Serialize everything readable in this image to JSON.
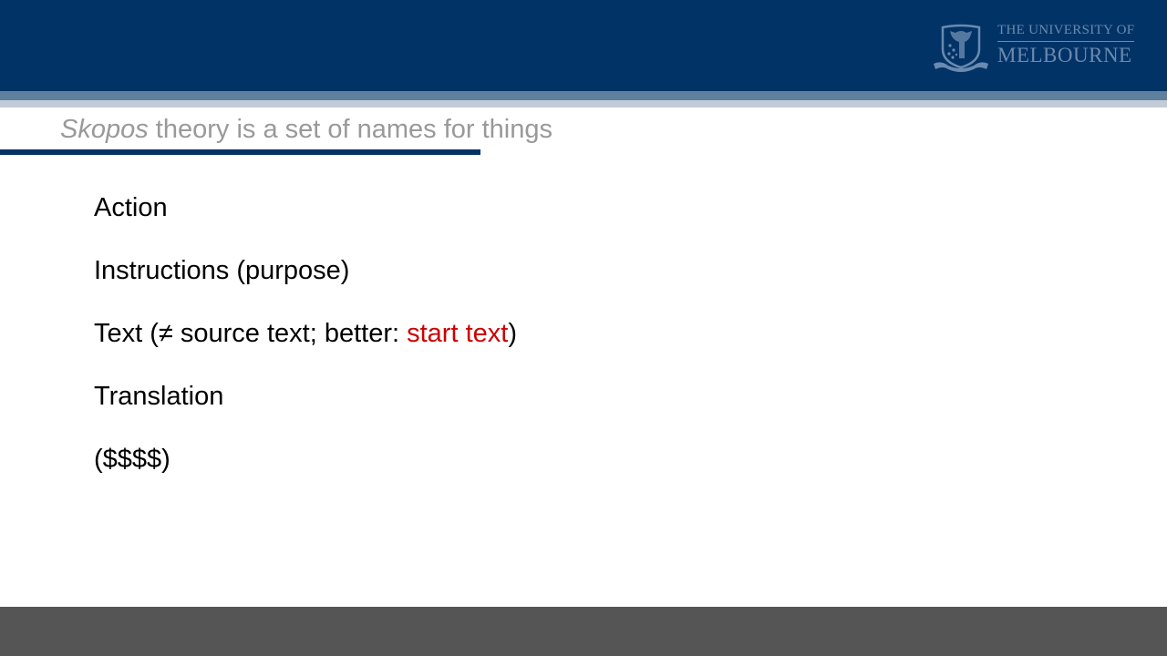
{
  "header": {
    "logo": {
      "line1": "THE UNIVERSITY OF",
      "line2": "MELBOURNE",
      "crest_icon": "university-crest-icon"
    }
  },
  "colors": {
    "brand_navy": "#023366",
    "stripe_mid": "#5f7f9f",
    "stripe_light": "#c2ccd8",
    "title_gray": "#999999",
    "highlight_red": "#cc0000",
    "footer_gray": "#555555"
  },
  "slide": {
    "title": {
      "italic_part": "Skopos",
      "rest": " theory is a set of names for things"
    },
    "bullets": [
      {
        "text": "Action"
      },
      {
        "text": "Instructions (purpose)"
      },
      {
        "prefix": "Text (≠ source text; better: ",
        "highlight": "start text",
        "suffix": ")"
      },
      {
        "text": "Translation"
      },
      {
        "text": "($$$$)"
      }
    ]
  }
}
